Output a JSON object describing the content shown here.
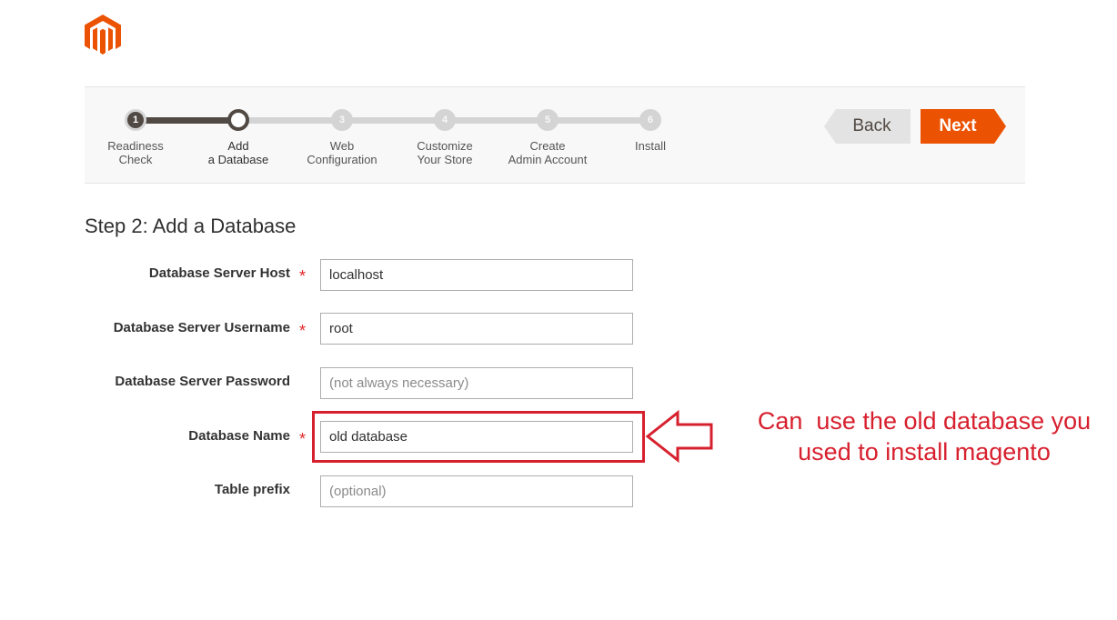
{
  "steps": [
    {
      "number": "1",
      "label_line1": "Readiness",
      "label_line2": "Check",
      "state": "done"
    },
    {
      "number": "2",
      "label_line1": "Add",
      "label_line2": "a Database",
      "state": "current"
    },
    {
      "number": "3",
      "label_line1": "Web",
      "label_line2": "Configuration",
      "state": "upcoming"
    },
    {
      "number": "4",
      "label_line1": "Customize",
      "label_line2": "Your Store",
      "state": "upcoming"
    },
    {
      "number": "5",
      "label_line1": "Create",
      "label_line2": "Admin Account",
      "state": "upcoming"
    },
    {
      "number": "6",
      "label_line1": "Install",
      "label_line2": "",
      "state": "upcoming"
    }
  ],
  "nav": {
    "back_label": "Back",
    "next_label": "Next"
  },
  "page": {
    "title": "Step 2: Add a Database"
  },
  "form": {
    "required_mark": "*",
    "fields": [
      {
        "label": "Database Server Host",
        "value": "localhost",
        "placeholder": "",
        "required": true
      },
      {
        "label": "Database Server Username",
        "value": "root",
        "placeholder": "",
        "required": true
      },
      {
        "label": "Database Server Password",
        "value": "",
        "placeholder": "(not always necessary)",
        "required": false
      },
      {
        "label": "Database Name",
        "value": "old database",
        "placeholder": "",
        "required": true
      },
      {
        "label": "Table prefix",
        "value": "",
        "placeholder": "(optional)",
        "required": false
      }
    ]
  },
  "annotation": {
    "line1": "Can  use the old database you",
    "line2": "used to install magento"
  },
  "colors": {
    "accent": "#eb5202",
    "annotation": "#d7202e",
    "track_done": "#514943",
    "track": "#d4d4d4"
  }
}
